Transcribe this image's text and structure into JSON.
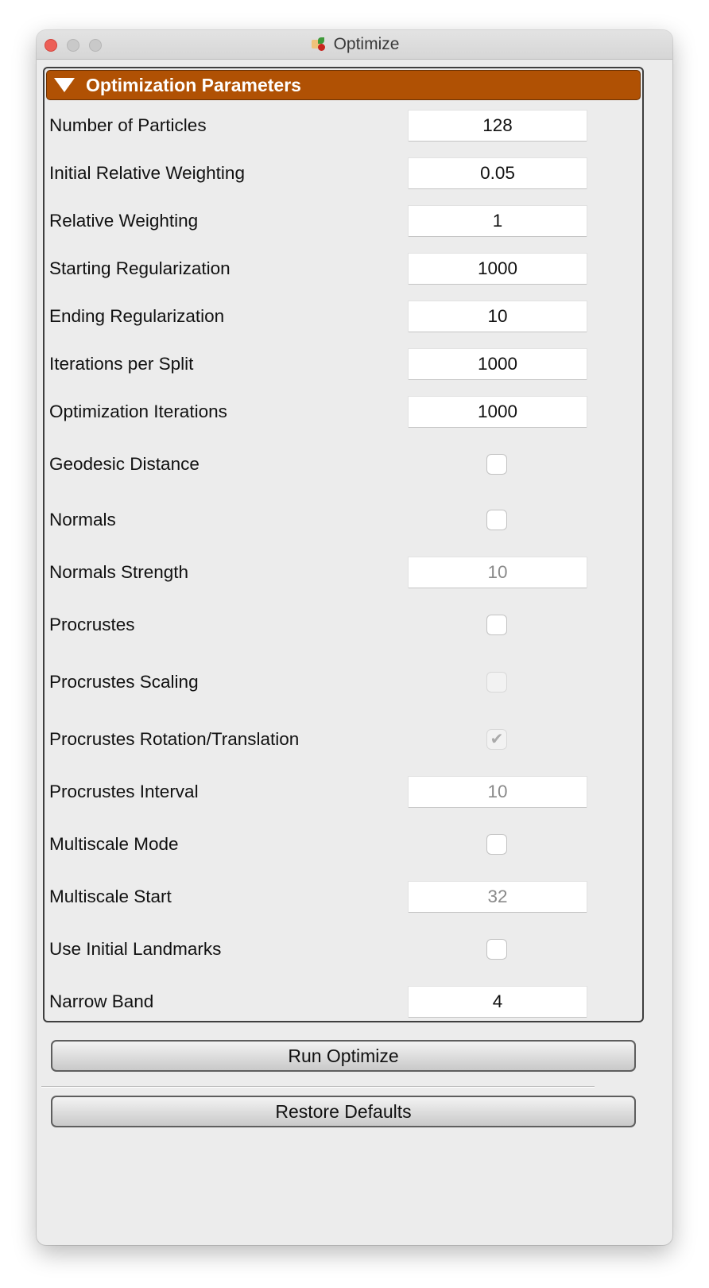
{
  "window": {
    "title": "Optimize",
    "app_icon": "shapeworks-app-icon"
  },
  "group": {
    "title": "Optimization Parameters",
    "expanded": true
  },
  "params": [
    {
      "label": "Number of Particles",
      "type": "field",
      "value": "128",
      "enabled": true
    },
    {
      "label": "Initial Relative Weighting",
      "type": "field",
      "value": "0.05",
      "enabled": true
    },
    {
      "label": "Relative Weighting",
      "type": "field",
      "value": "1",
      "enabled": true
    },
    {
      "label": "Starting Regularization",
      "type": "field",
      "value": "1000",
      "enabled": true
    },
    {
      "label": "Ending Regularization",
      "type": "field",
      "value": "10",
      "enabled": true
    },
    {
      "label": "Iterations per Split",
      "type": "field",
      "value": "1000",
      "enabled": true
    },
    {
      "label": "Optimization Iterations",
      "type": "field",
      "value": "1000",
      "enabled": true
    },
    {
      "label": "Geodesic Distance",
      "type": "checkbox",
      "checked": false,
      "enabled": true
    },
    {
      "label": "Normals",
      "type": "checkbox",
      "checked": false,
      "enabled": true
    },
    {
      "label": "Normals Strength",
      "type": "field",
      "value": "10",
      "enabled": false
    },
    {
      "label": "Procrustes",
      "type": "checkbox",
      "checked": false,
      "enabled": true
    },
    {
      "label": "Procrustes Scaling",
      "type": "checkbox",
      "checked": false,
      "enabled": false
    },
    {
      "label": "Procrustes Rotation/Translation",
      "type": "checkbox",
      "checked": true,
      "enabled": false
    },
    {
      "label": "Procrustes Interval",
      "type": "field",
      "value": "10",
      "enabled": false
    },
    {
      "label": "Multiscale Mode",
      "type": "checkbox",
      "checked": false,
      "enabled": true
    },
    {
      "label": "Multiscale Start",
      "type": "field",
      "value": "32",
      "enabled": false
    },
    {
      "label": "Use Initial Landmarks",
      "type": "checkbox",
      "checked": false,
      "enabled": true
    },
    {
      "label": "Narrow Band",
      "type": "field",
      "value": "4",
      "enabled": true
    }
  ],
  "buttons": {
    "run": "Run Optimize",
    "restore": "Restore Defaults"
  }
}
